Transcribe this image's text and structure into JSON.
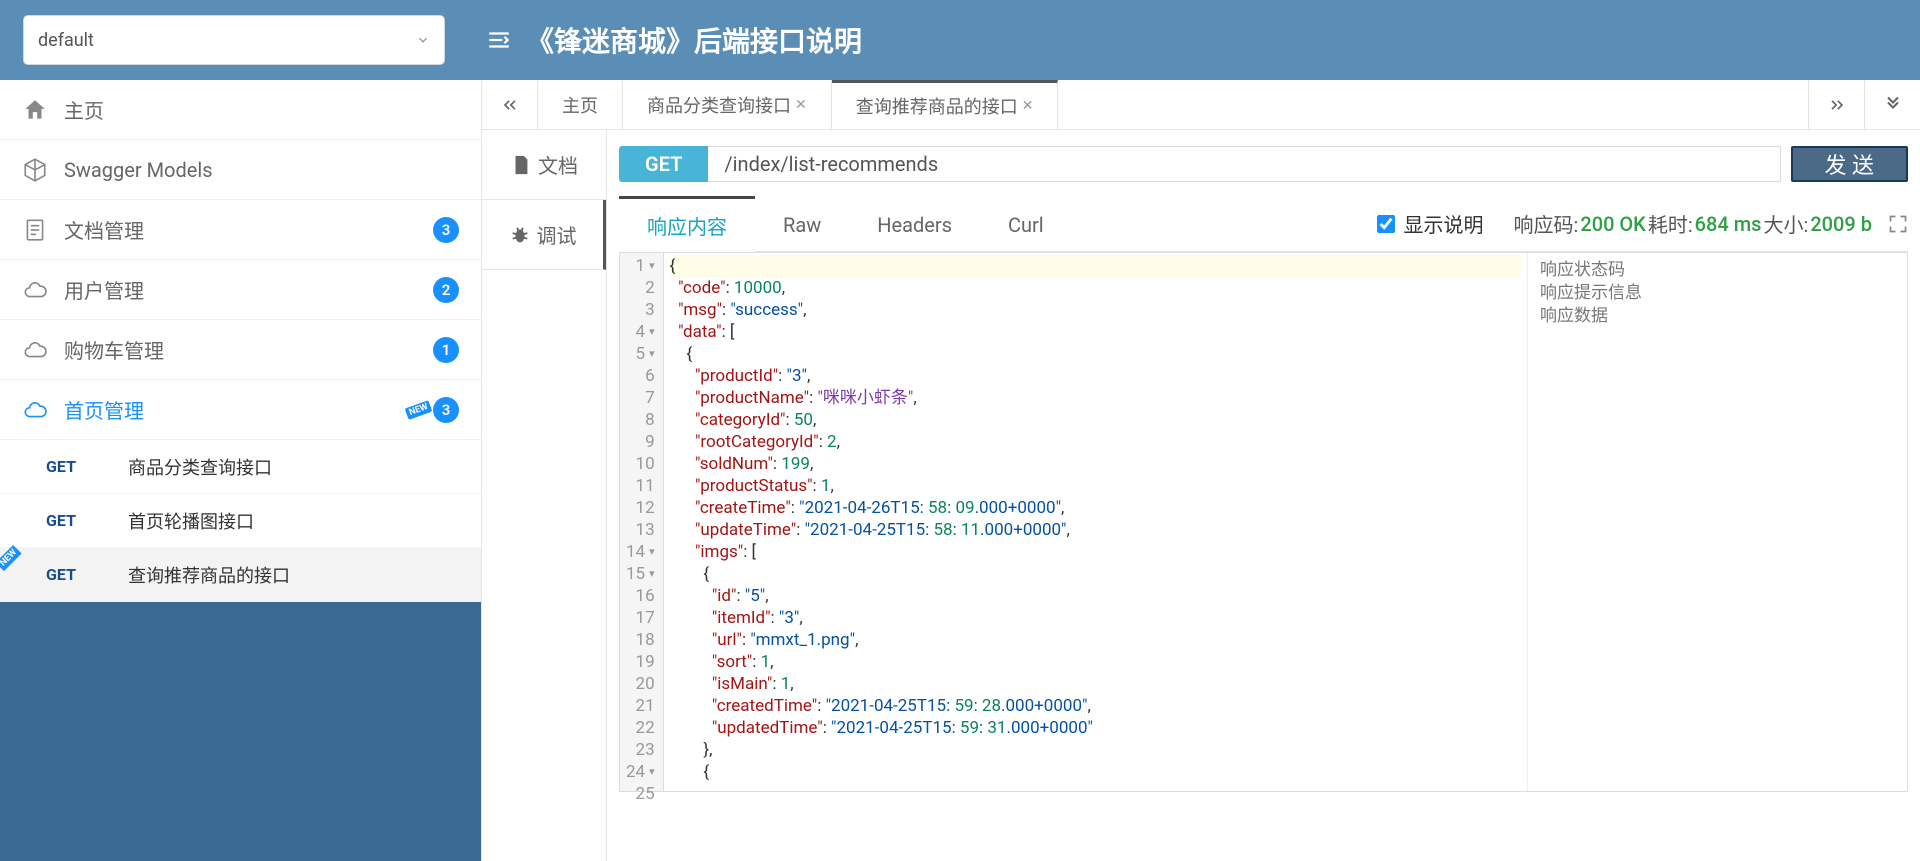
{
  "header": {
    "select_value": "default",
    "title": "《锋迷商城》后端接口说明"
  },
  "sidebar": {
    "home": "主页",
    "swagger": "Swagger Models",
    "items": [
      {
        "label": "文档管理",
        "badge": "3"
      },
      {
        "label": "用户管理",
        "badge": "2"
      },
      {
        "label": "购物车管理",
        "badge": "1"
      },
      {
        "label": "首页管理",
        "badge": "3",
        "new": true,
        "active": true
      }
    ],
    "subs": [
      {
        "method": "GET",
        "label": "商品分类查询接口"
      },
      {
        "method": "GET",
        "label": "首页轮播图接口"
      },
      {
        "method": "GET",
        "label": "查询推荐商品的接口",
        "selected": true
      }
    ]
  },
  "tabs": {
    "items": [
      {
        "label": "主页",
        "closable": false
      },
      {
        "label": "商品分类查询接口",
        "closable": true
      },
      {
        "label": "查询推荐商品的接口",
        "closable": true,
        "active": true
      }
    ]
  },
  "side_tabs": {
    "doc": "文档",
    "debug": "调试"
  },
  "request": {
    "method": "GET",
    "url": "/index/list-recommends",
    "send": "发 送"
  },
  "resp_tabs": {
    "content": "响应内容",
    "raw": "Raw",
    "headers": "Headers",
    "curl": "Curl"
  },
  "toolbar": {
    "show_desc": "显示说明",
    "status_lbl": "响应码:",
    "status_val": "200 OK",
    "time_lbl": "耗时:",
    "time_val": "684 ms",
    "size_lbl": "大小:",
    "size_val": "2009 b"
  },
  "desc": {
    "l1": "响应状态码",
    "l2": "响应提示信息",
    "l3": "响应数据"
  },
  "response_json": {
    "code": 10000,
    "msg": "success",
    "data": [
      {
        "productId": "3",
        "productName": "咪咪小虾条",
        "categoryId": 50,
        "rootCategoryId": 2,
        "soldNum": 199,
        "productStatus": 1,
        "createTime": "2021-04-26T15:58:09.000+0000",
        "updateTime": "2021-04-25T15:58:11.000+0000",
        "imgs": [
          {
            "id": "5",
            "itemId": "3",
            "url": "mmxt_1.png",
            "sort": 1,
            "isMain": 1,
            "createdTime": "2021-04-25T15:59:28.000+0000",
            "updatedTime": "2021-04-25T15:59:31.000+0000"
          }
        ]
      }
    ]
  }
}
